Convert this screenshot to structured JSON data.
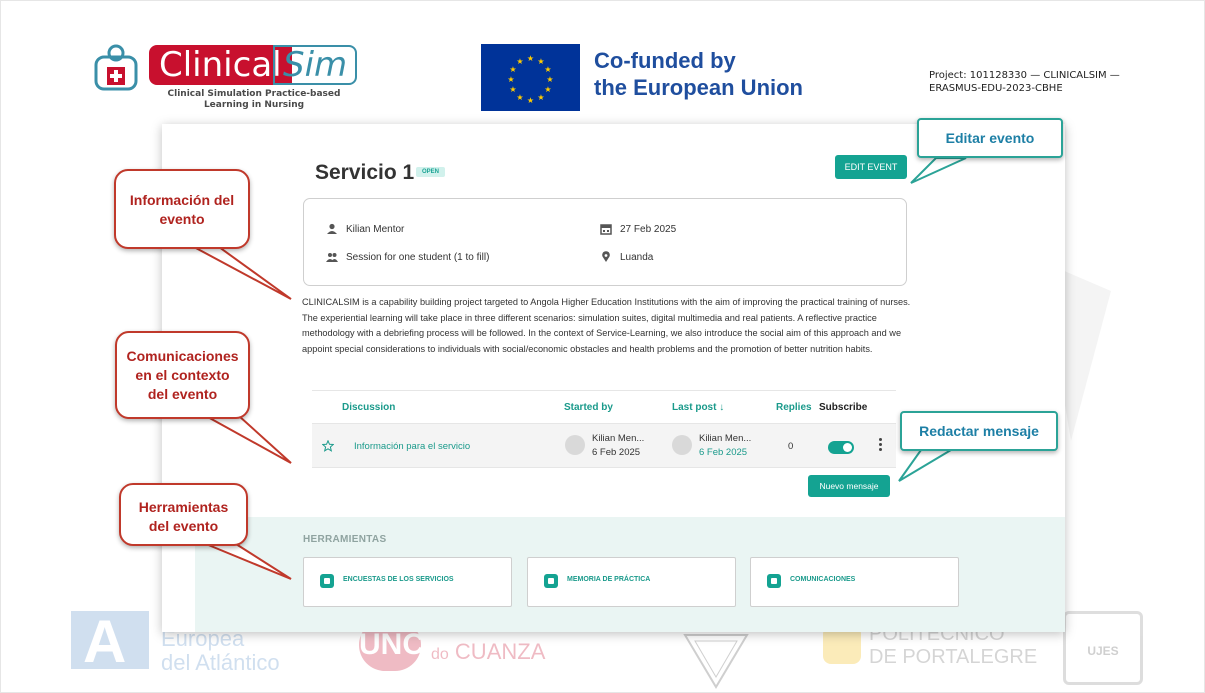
{
  "header": {
    "logo_clinical": "Clinical",
    "logo_sim": "Sim",
    "logo_subtitle": "Clinical Simulation Practice-based Learning in Nursing",
    "eu_line1": "Co-funded by",
    "eu_line2": "the European Union",
    "project": "Project: 101128330 — CLINICALSIM — ERASMUS-EDU-2023-CBHE"
  },
  "watermarks": {
    "europea": "Europea",
    "atlantico": "del Atlántico",
    "unc": "UNC",
    "cuanza_do": "do",
    "cuanza": "CUANZA",
    "politecnico": "POLITÉCNICO",
    "portalegre": "DE PORTALEGRE",
    "ujes": "UJES"
  },
  "event": {
    "title": "Servicio 1",
    "status": "OPEN",
    "edit_label": "EDIT EVENT",
    "mentor": "Kilian Mentor",
    "date": "27 Feb 2025",
    "session": "Session for one student (1 to fill)",
    "location": "Luanda",
    "description": "CLINICALSIM is a capability building project targeted to Angola Higher Education Institutions with the aim of improving the practical training of nurses. The experiential learning will take place in three different scenarios: simulation suites, digital multimedia and real patients. A reflective practice methodology with a debriefing process will be followed. In the context of Service-Learning, we also introduce the social aim of this approach and we appoint special considerations to individuals with social/economic obstacles and health problems and the promotion of better nutrition habits."
  },
  "discussion_table": {
    "headers": {
      "discussion": "Discussion",
      "started_by": "Started by",
      "last_post": "Last post ↓",
      "replies": "Replies",
      "subscribe": "Subscribe"
    },
    "rows": [
      {
        "title": "Información para el servicio",
        "started_name": "Kilian Men...",
        "started_date": "6 Feb 2025",
        "last_name": "Kilian Men...",
        "last_date": "6 Feb 2025",
        "replies": "0",
        "subscribed": true
      }
    ],
    "new_message": "Nuevo mensaje"
  },
  "tools": {
    "title": "HERRAMIENTAS",
    "items": [
      {
        "label": "ENCUESTAS DE LOS SERVICIOS"
      },
      {
        "label": "MEMORIA DE PRÁCTICA"
      },
      {
        "label": "COMUNICACIONES"
      }
    ]
  },
  "callouts": {
    "info_line1": "Información del",
    "info_line2": "evento",
    "comms_line1": "Comunicaciones",
    "comms_line2": "en el contexto",
    "comms_line3": "del evento",
    "tools_line1": "Herramientas",
    "tools_line2": "del evento",
    "edit": "Editar evento",
    "compose": "Redactar mensaje"
  },
  "colors": {
    "accent": "#14a392",
    "callout_red": "#c0392b",
    "callout_teal": "#2ba397",
    "brand_red": "#c8102e",
    "eu_blue": "#003399"
  }
}
